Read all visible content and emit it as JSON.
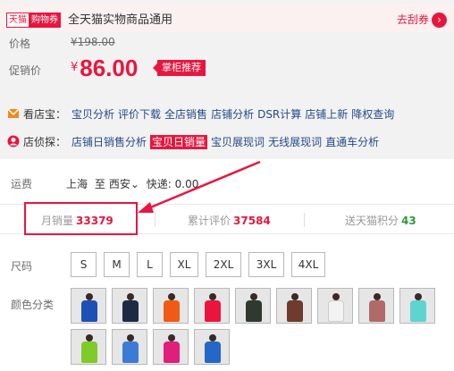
{
  "coupon": {
    "tmall_badge": "天猫",
    "coupon_badge": "购物券",
    "text": "全天猫实物商品通用",
    "link": "去刮券"
  },
  "price": {
    "label": "价格",
    "original": "¥198.00"
  },
  "promo_price": {
    "label": "促销价",
    "currency": "¥",
    "value": "86.00",
    "tag": "掌柜推荐"
  },
  "tools": {
    "row1": {
      "label": "看店宝：",
      "links": [
        "宝贝分析",
        "评价下载",
        "全店销售",
        "店铺分析",
        "DSR计算",
        "店铺上新",
        "降权查询"
      ]
    },
    "row2": {
      "label": "店侦探：",
      "links": [
        "店铺日销售分析",
        "宝贝日销量",
        "宝贝展现词",
        "无线展现词",
        "直通车分析"
      ],
      "active_index": 1
    }
  },
  "shipping": {
    "label": "运费",
    "from": "上海",
    "to_word": "至",
    "dest": "西安",
    "express": "快递: 0.00"
  },
  "stats": {
    "monthly_sales_label": "月销量",
    "monthly_sales": "33379",
    "reviews_label": "累计评价",
    "reviews": "37584",
    "points_label": "送天猫积分",
    "points": "43"
  },
  "sizes": {
    "label": "尺码",
    "options": [
      "S",
      "M",
      "L",
      "XL",
      "2XL",
      "3XL",
      "4XL"
    ]
  },
  "colors": {
    "label": "颜色分类",
    "swatch_colors": [
      "#1d4fb5",
      "#1c2a44",
      "#ef5a17",
      "#e8163f",
      "#2e3a2f",
      "#6e3b2c",
      "#f2f2f2",
      "#b06a6a",
      "#5fd3d0",
      "#7ecb2a",
      "#3d7ad6",
      "#df1f7a",
      "#2567c7"
    ]
  },
  "theme": {
    "accent": "#e8163f",
    "link": "#234a8b",
    "green": "#2e9a3a"
  }
}
